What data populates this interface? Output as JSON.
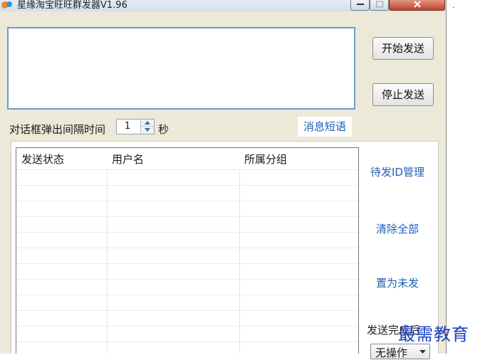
{
  "window": {
    "title": "星缘淘宝旺旺群发器V1.96"
  },
  "message_box": {
    "value": ""
  },
  "buttons": {
    "start_label": "开始发送",
    "stop_label": "停止发送"
  },
  "interval": {
    "label": "对话框弹出间隔时间",
    "value": "1",
    "unit": "秒"
  },
  "quick_phrase_tab": "消息短语",
  "table": {
    "columns": [
      "发送状态",
      "用户名",
      "所属分组"
    ],
    "rows": []
  },
  "side_actions": {
    "manage_ids": "待发ID管理",
    "clear_all": "清除全部",
    "mark_unsent": "置为未发"
  },
  "after_send": {
    "label": "发送完成后",
    "selected": "无操作"
  },
  "watermark": "最需教育",
  "colors": {
    "accent_border": "#6a9bd0",
    "link_blue": "#1f5fb4",
    "window_bg": "#ece9d8",
    "close_red": "#c0432a"
  }
}
